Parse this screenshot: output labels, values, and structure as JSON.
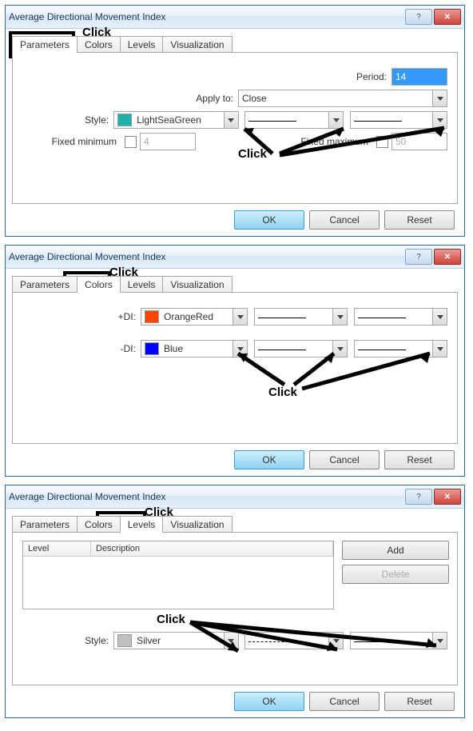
{
  "dialogs": [
    {
      "title": "Average Directional Movement Index",
      "tabs": [
        "Parameters",
        "Colors",
        "Levels",
        "Visualization"
      ],
      "active_tab": "Parameters",
      "annot_top": "Click",
      "annot_center": "Click",
      "fields": {
        "period_label": "Period:",
        "period_value": "14",
        "apply_label": "Apply to:",
        "apply_value": "Close",
        "style_label": "Style:",
        "style_value": "LightSeaGreen",
        "style_color": "#20b2aa",
        "fmin_label": "Fixed minimum",
        "fmin_value": "4",
        "fmax_label": "Fixed maximum",
        "fmax_value": "50"
      },
      "buttons": {
        "ok": "OK",
        "cancel": "Cancel",
        "reset": "Reset"
      }
    },
    {
      "title": "Average Directional Movement Index",
      "tabs": [
        "Parameters",
        "Colors",
        "Levels",
        "Visualization"
      ],
      "active_tab": "Colors",
      "annot_top": "Click",
      "annot_center": "Click",
      "rows": [
        {
          "label": "+DI:",
          "value": "OrangeRed",
          "color": "#ff4500"
        },
        {
          "label": "-DI:",
          "value": "Blue",
          "color": "#0000ff"
        }
      ],
      "buttons": {
        "ok": "OK",
        "cancel": "Cancel",
        "reset": "Reset"
      }
    },
    {
      "title": "Average Directional Movement Index",
      "tabs": [
        "Parameters",
        "Colors",
        "Levels",
        "Visualization"
      ],
      "active_tab": "Levels",
      "annot_top": "Click",
      "annot_center": "Click",
      "list": {
        "col1": "Level",
        "col2": "Description"
      },
      "side": {
        "add": "Add",
        "delete": "Delete"
      },
      "style_label": "Style:",
      "style_value": "Silver",
      "style_color": "#c0c0c0",
      "buttons": {
        "ok": "OK",
        "cancel": "Cancel",
        "reset": "Reset"
      }
    }
  ]
}
